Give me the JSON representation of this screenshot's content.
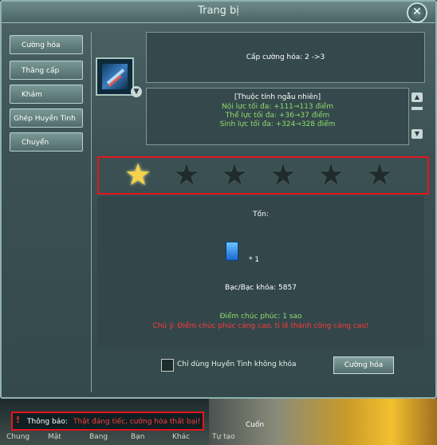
{
  "window": {
    "title": "Trang bị",
    "close_label": "✕"
  },
  "sidebar": {
    "items": [
      {
        "label": "Cường hóa"
      },
      {
        "label": "Thăng cấp"
      },
      {
        "label": "Khảm"
      },
      {
        "label": "Ghép Huyền Tinh"
      },
      {
        "label": "Chuyển"
      }
    ]
  },
  "level": {
    "text": "Cấp cường hóa: 2 ->3"
  },
  "attributes": {
    "header": "[Thuộc tính ngẫu nhiên]",
    "lines": [
      "Nội lực tối đa: +111→113 điểm",
      "Thể lực tối đa: +36→37 điểm",
      "Sinh lực tối đa: +324→328 điểm"
    ]
  },
  "stars": {
    "filled": 1,
    "total": 6,
    "filled_color": "#f6d24a",
    "empty_color": "#1f2b2c"
  },
  "cost": {
    "ton_label": "Tốn:",
    "gem_count": "* 1",
    "silver": "Bạc/Bạc khóa: 5857",
    "blessing": "Điểm chúc phúc: 1 sao",
    "note": "Chú ý: Điểm chúc phúc càng cao, tỉ lệ thành công càng cao!"
  },
  "options": {
    "checkbox_label": "Chỉ dùng Huyền Tinh không khóa",
    "confirm_button": "Cường hóa"
  },
  "notice": {
    "label": "Thông báo:",
    "text": "Thật đáng tiếc, cường hóa thất bại!",
    "scroll_label": "Cuốn"
  },
  "chat_tabs": [
    "Chung",
    "Mật",
    "Bang",
    "Bạn",
    "Khác",
    "Tự tạo"
  ],
  "colors": {
    "accent_red": "#e4161e",
    "green_text": "#8fdc6c",
    "warning_text": "#ff3a3a"
  }
}
